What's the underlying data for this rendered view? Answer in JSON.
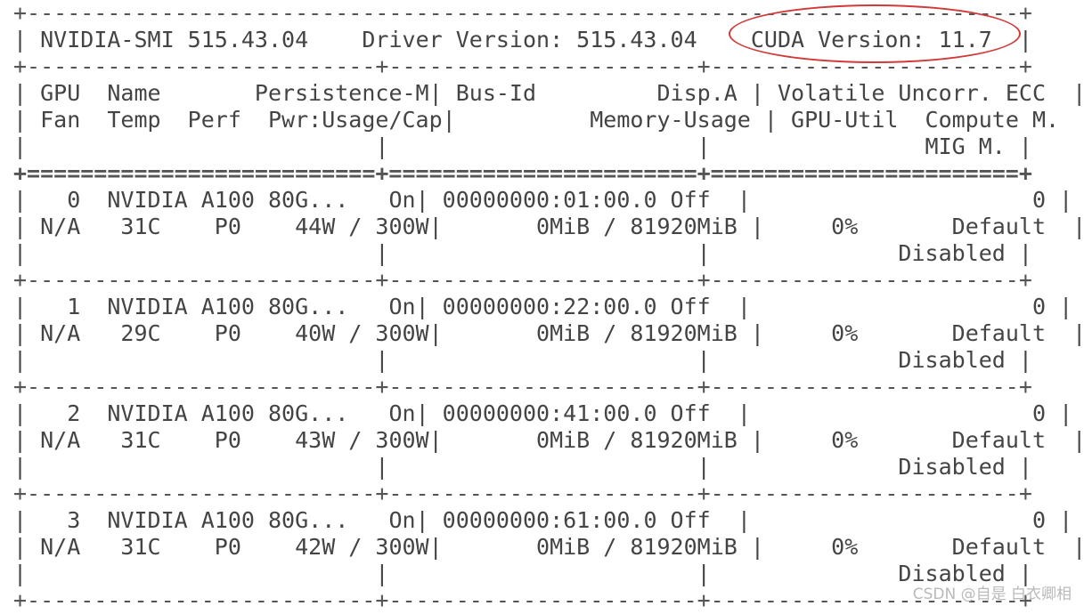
{
  "header": {
    "smi_label": "NVIDIA-SMI 515.43.04",
    "driver_label": "Driver Version: 515.43.04",
    "cuda_label": "CUDA Version: 11.7"
  },
  "columns": {
    "line1": {
      "gpu": "GPU",
      "name": "Name",
      "persistence": "Persistence-M",
      "bus": "Bus-Id",
      "disp": "Disp.A",
      "volatile": "Volatile",
      "ecc": "Uncorr. ECC"
    },
    "line2": {
      "fan": "Fan",
      "temp": "Temp",
      "perf": "Perf",
      "pwr": "Pwr:Usage/Cap",
      "memory": "Memory-Usage",
      "util": "GPU-Util",
      "compute": "Compute M."
    },
    "line3": {
      "mig": "MIG M."
    }
  },
  "gpus": [
    {
      "index": "0",
      "name": "NVIDIA A100 80G...",
      "persistence": "On",
      "bus_id": "00000000:01:00.0",
      "disp": "Off",
      "ecc": "0",
      "fan": "N/A",
      "temp": "31C",
      "perf": "P0",
      "power": "44W / 300W",
      "memory": "0MiB / 81920MiB",
      "util": "0%",
      "compute": "Default",
      "mig": "Disabled"
    },
    {
      "index": "1",
      "name": "NVIDIA A100 80G...",
      "persistence": "On",
      "bus_id": "00000000:22:00.0",
      "disp": "Off",
      "ecc": "0",
      "fan": "N/A",
      "temp": "29C",
      "perf": "P0",
      "power": "40W / 300W",
      "memory": "0MiB / 81920MiB",
      "util": "0%",
      "compute": "Default",
      "mig": "Disabled"
    },
    {
      "index": "2",
      "name": "NVIDIA A100 80G...",
      "persistence": "On",
      "bus_id": "00000000:41:00.0",
      "disp": "Off",
      "ecc": "0",
      "fan": "N/A",
      "temp": "31C",
      "perf": "P0",
      "power": "43W / 300W",
      "memory": "0MiB / 81920MiB",
      "util": "0%",
      "compute": "Default",
      "mig": "Disabled"
    },
    {
      "index": "3",
      "name": "NVIDIA A100 80G...",
      "persistence": "On",
      "bus_id": "00000000:61:00.0",
      "disp": "Off",
      "ecc": "0",
      "fan": "N/A",
      "temp": "31C",
      "perf": "P0",
      "power": "42W / 300W",
      "memory": "0MiB / 81920MiB",
      "util": "0%",
      "compute": "Default",
      "mig": "Disabled"
    }
  ],
  "annotation": {
    "color": "#d23a3a"
  },
  "watermark": "CSDN @自是 白衣卿相"
}
